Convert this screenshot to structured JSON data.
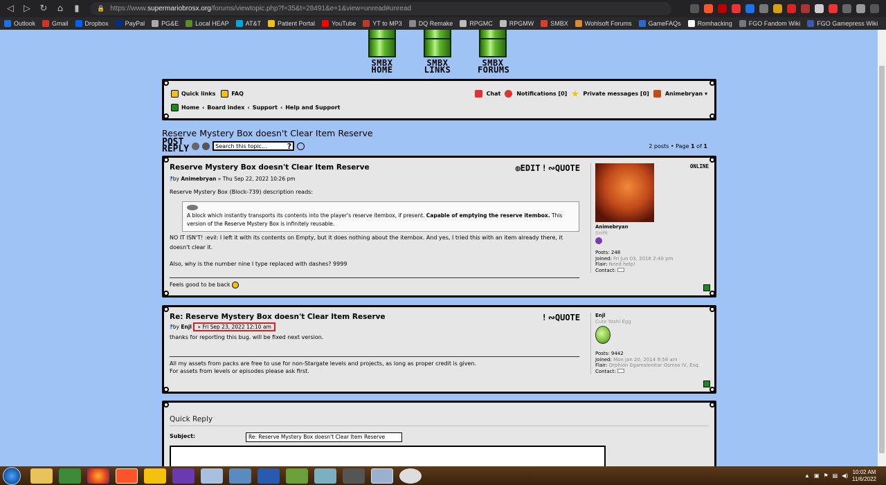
{
  "browser": {
    "url_prefix": "https://www.",
    "url_domain": "supermariobrosx.org",
    "url_path": "/forums/viewtopic.php?f=35&t=28491&e=1&view=unread#unread"
  },
  "bookmarks": [
    {
      "label": "Outlook",
      "color": "#1a73e8"
    },
    {
      "label": "Gmail",
      "color": "#d93025"
    },
    {
      "label": "Dropbox",
      "color": "#0061ff"
    },
    {
      "label": "PayPal",
      "color": "#003087"
    },
    {
      "label": "PG&E",
      "color": "#aaaaaa"
    },
    {
      "label": "Local HEAP",
      "color": "#5f8a2a"
    },
    {
      "label": "AT&T",
      "color": "#00a8e0"
    },
    {
      "label": "Patient Portal",
      "color": "#f4c20d"
    },
    {
      "label": "YouTube",
      "color": "#ff0000"
    },
    {
      "label": "YT to MP3",
      "color": "#c0392b"
    },
    {
      "label": "DQ Remake",
      "color": "#888888"
    },
    {
      "label": "RPGMC",
      "color": "#bbbbbb"
    },
    {
      "label": "RPGMW",
      "color": "#bbbbbb"
    },
    {
      "label": "SMBX",
      "color": "#e03a2a"
    },
    {
      "label": "Wohlsoft Forums",
      "color": "#e08a2a"
    },
    {
      "label": "GameFAQs",
      "color": "#2a6ad0"
    },
    {
      "label": "Romhacking",
      "color": "#ffffff"
    },
    {
      "label": "FGO Fandom Wiki",
      "color": "#777777"
    },
    {
      "label": "FGO Gamepress Wiki",
      "color": "#3a5ab0"
    }
  ],
  "pipes": [
    "SMBX\nHOME",
    "SMBX\nLINKS",
    "SMBX\nFORUMS"
  ],
  "navbar": {
    "quick_links": "Quick links",
    "faq": "FAQ",
    "chat": "Chat",
    "notifications": "Notifications [0]",
    "private_messages": "Private messages [0]",
    "user": "Animebryan",
    "breadcrumb": [
      "Home",
      "Board index",
      "Support",
      "Help and Support"
    ]
  },
  "topic": {
    "title": "Reserve Mystery Box doesn't Clear Item Reserve",
    "post_reply": "POST\nREPLY",
    "search_placeholder": "Search this topic...",
    "pagination_prefix": "2 posts • Page ",
    "page_current": "1",
    "page_of": " of ",
    "page_total": "1"
  },
  "posts": [
    {
      "title": "Reserve Mystery Box doesn't Clear Item Reserve",
      "by": "by ",
      "author": "Animebryan",
      "date": " » Thu Sep 22, 2022 10:26 pm",
      "buttons": {
        "edit": "EDIT",
        "quote": "QUOTE"
      },
      "intro": "Reserve Mystery Box (Block-739) description reads:",
      "quote_text_1": "A block which instantly transports its contents into the player's reserve itembox, if present. ",
      "quote_bold": "Capable of emptying the reserve itembox.",
      "quote_text_2": " This version of the Reserve Mystery Box is infinitely reusable.",
      "para1": "NO IT ISN'T! :evil: I left it with its contents on Empty, but it does nothing about the itembox. And yes, I tried this with an item already there, it doesn't clear it.",
      "para2": "Also, why is the number nine I type replaced with dashes? 9999",
      "signature": "Feels good to be back",
      "profile": {
        "status": "ONLINE",
        "name": "Animebryan",
        "rank": "Snifit",
        "posts_label": "Posts: ",
        "posts": "248",
        "joined_label": "Joined: ",
        "joined": "Fri Jun 03, 2016 2:40 pm",
        "flair_label": "Flair: ",
        "flair": "Need help!",
        "contact_label": "Contact:"
      }
    },
    {
      "title": "Re: Reserve Mystery Box doesn't Clear Item Reserve",
      "by": "by ",
      "author": "Enjl",
      "date": "» Fri Sep 23, 2022 12:10 am",
      "buttons": {
        "quote": "QUOTE"
      },
      "body": "thanks for reporting this bug. will be fixed next version.",
      "signature_1": "All my assets from packs are free to use for non-Stargate levels and projects, as long as proper credit is given.",
      "signature_2": "For assets from levels or episodes please ask first.",
      "profile": {
        "name": "Enjl",
        "rank": "Cute Yoshi Egg",
        "posts_label": "Posts: ",
        "posts": "9442",
        "joined_label": "Joined: ",
        "joined": "Mon Jan 20, 2014 9:58 am",
        "flair_label": "Flair: ",
        "flair": "Orphion Egamalenitar Osmos IV, Esq.",
        "contact_label": "Contact:"
      }
    }
  ],
  "quick_reply": {
    "title": "Quick Reply",
    "subject_label": "Subject:",
    "subject_value": "Re: Reserve Mystery Box doesn't Clear Item Reserve"
  },
  "taskbar": {
    "time": "10:02 AM",
    "date": "11/6/2022"
  }
}
